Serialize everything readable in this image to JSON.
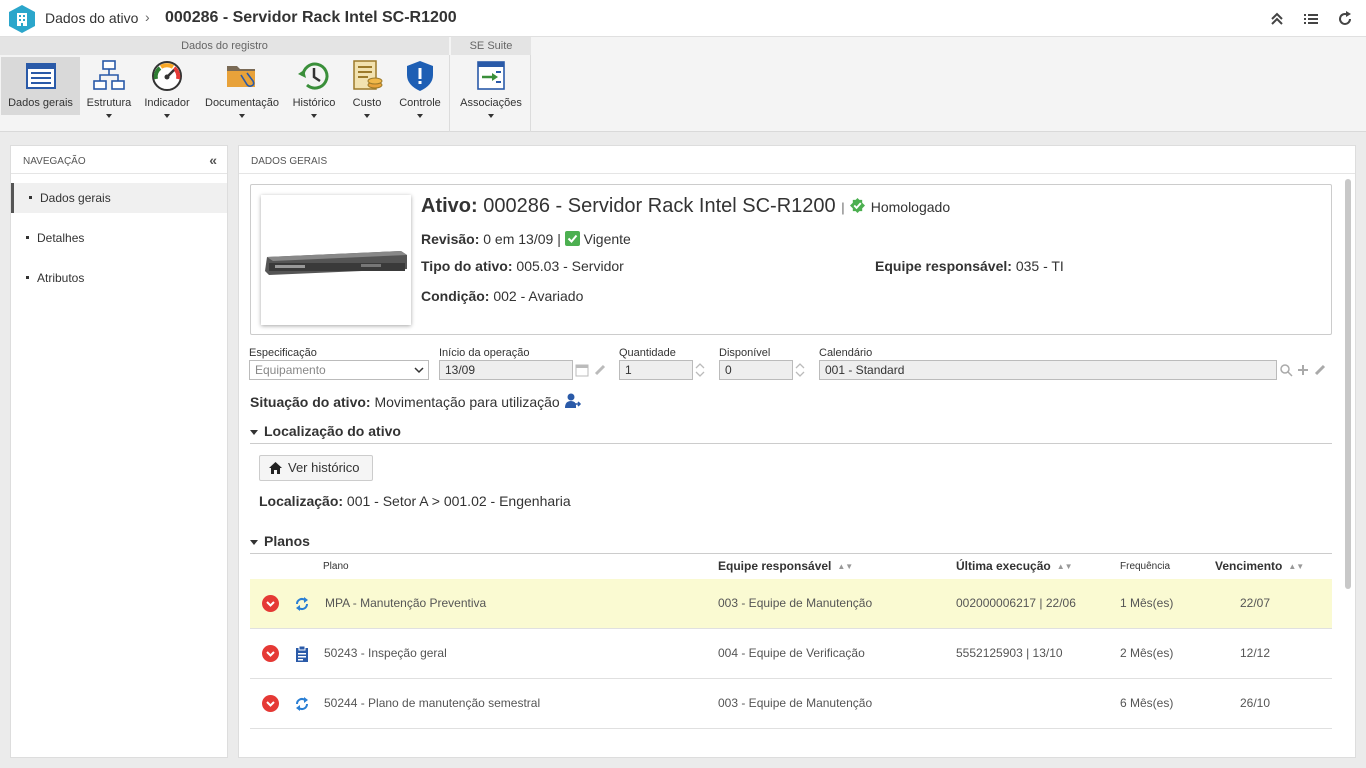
{
  "header": {
    "breadcrumb_root": "Dados do ativo",
    "separator": "›",
    "title": "000286 - Servidor Rack Intel SC-R1200"
  },
  "ribbon": {
    "groups": [
      {
        "label": "Dados do registro"
      },
      {
        "label": "SE Suite"
      }
    ],
    "buttons": [
      {
        "label": "Dados gerais",
        "icon": "general-data-icon"
      },
      {
        "label": "Estrutura",
        "icon": "structure-icon"
      },
      {
        "label": "Indicador",
        "icon": "gauge-icon"
      },
      {
        "label": "Documentação",
        "icon": "folder-icon"
      },
      {
        "label": "Histórico",
        "icon": "history-icon"
      },
      {
        "label": "Custo",
        "icon": "cost-icon"
      },
      {
        "label": "Controle",
        "icon": "shield-icon"
      },
      {
        "label": "Associações",
        "icon": "associations-icon"
      }
    ]
  },
  "navigation": {
    "title": "NAVEGAÇÃO",
    "collapse": "«",
    "items": [
      {
        "label": "Dados gerais"
      },
      {
        "label": "Detalhes"
      },
      {
        "label": "Atributos"
      }
    ]
  },
  "main": {
    "section_title": "DADOS GERAIS",
    "asset": {
      "label": "Ativo:",
      "value": "000286 - Servidor Rack Intel SC-R1200",
      "pipe": "|",
      "status": "Homologado",
      "revision_label": "Revisão:",
      "revision_value": "0 em 13/09 |",
      "revision_status": "Vigente",
      "type_label": "Tipo do ativo:",
      "type_value": "005.03 - Servidor",
      "team_label": "Equipe responsável:",
      "team_value": "035 - TI",
      "condition_label": "Condição:",
      "condition_value": "002 - Avariado"
    },
    "fields": {
      "spec_label": "Especificação",
      "spec_value": "Equipamento",
      "start_label": "Início da operação",
      "start_value": "13/09",
      "qty_label": "Quantidade",
      "qty_value": "1",
      "avail_label": "Disponível",
      "avail_value": "0",
      "calendar_label": "Calendário",
      "calendar_value": "001 - Standard"
    },
    "situation": {
      "label": "Situação do ativo:",
      "value": "Movimentação para utilização"
    },
    "location": {
      "title": "Localização do ativo",
      "history_button": "Ver histórico",
      "label": "Localização:",
      "value": "001 - Setor A > 001.02 - Engenharia"
    },
    "plans": {
      "title": "Planos",
      "columns": {
        "plan": "Plano",
        "team": "Equipe responsável",
        "last": "Última execução",
        "freq": "Frequência",
        "due": "Vencimento"
      },
      "rows": [
        {
          "plan": "MPA - Manutenção Preventiva",
          "team": "003 - Equipe de Manutenção",
          "last": "002000006217 | 22/06",
          "freq": "1 Mês(es)",
          "due": "22/07",
          "icon": "cycle-icon"
        },
        {
          "plan": "50243 - Inspeção geral",
          "team": "004 - Equipe de Verificação",
          "last": "5552125903 | 13/10",
          "freq": "2 Mês(es)",
          "due": "12/12",
          "icon": "clipboard-icon"
        },
        {
          "plan": "50244 - Plano de manutenção semestral",
          "team": "003 - Equipe de Manutenção",
          "last": "",
          "freq": "6 Mês(es)",
          "due": "26/10",
          "icon": "cycle-icon"
        }
      ]
    }
  },
  "colors": {
    "accent": "#2ba6cb",
    "green": "#4caf50",
    "red": "#e53935",
    "highlight_row": "#fafad2"
  }
}
